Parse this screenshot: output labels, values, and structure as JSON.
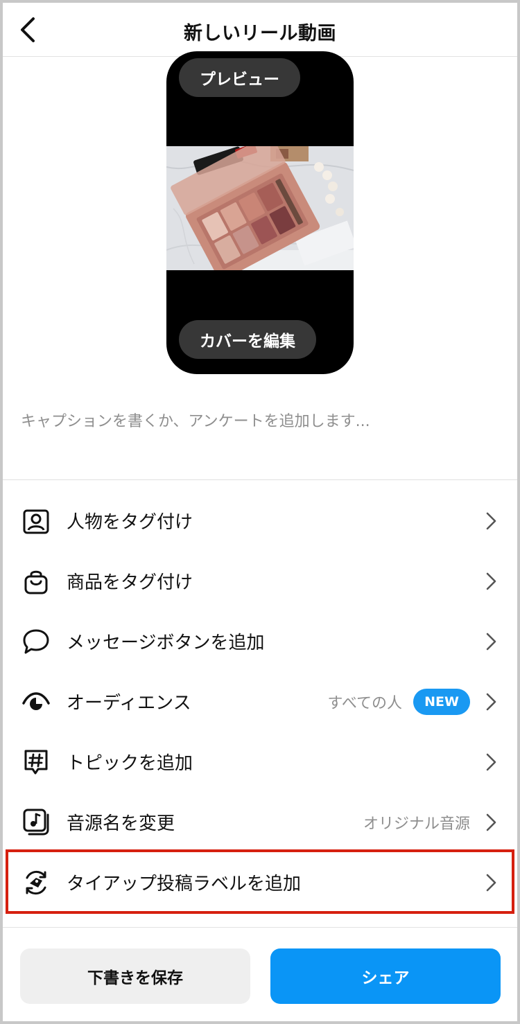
{
  "header": {
    "title": "新しいリール動画",
    "back_icon": "chevron-left-icon"
  },
  "preview": {
    "preview_label": "プレビュー",
    "edit_cover_label": "カバーを編集",
    "media_description": "cosmetics-eyeshadow-palette-photo"
  },
  "caption": {
    "placeholder": "キャプションを書くか、アンケートを追加します..."
  },
  "options": [
    {
      "label": "人物をタグ付け",
      "icon": "person-tag-icon",
      "value": ""
    },
    {
      "label": "商品をタグ付け",
      "icon": "shopping-bag-icon",
      "value": ""
    },
    {
      "label": "メッセージボタンを追加",
      "icon": "message-bubble-icon",
      "value": ""
    },
    {
      "label": "オーディエンス",
      "icon": "eye-icon",
      "value": "すべての人",
      "badge": "NEW"
    },
    {
      "label": "トピックを追加",
      "icon": "hashtag-icon",
      "value": ""
    },
    {
      "label": "音源名を変更",
      "icon": "music-note-icon",
      "value": "オリジナル音源"
    },
    {
      "label": "タイアップ投稿ラベルを追加",
      "icon": "handshake-tag-icon",
      "value": ""
    }
  ],
  "actions": {
    "save_draft": "下書きを保存",
    "share": "シェア"
  },
  "colors": {
    "accent": "#0a95f6",
    "badge": "#1a99f2",
    "highlight": "#d6200f"
  }
}
